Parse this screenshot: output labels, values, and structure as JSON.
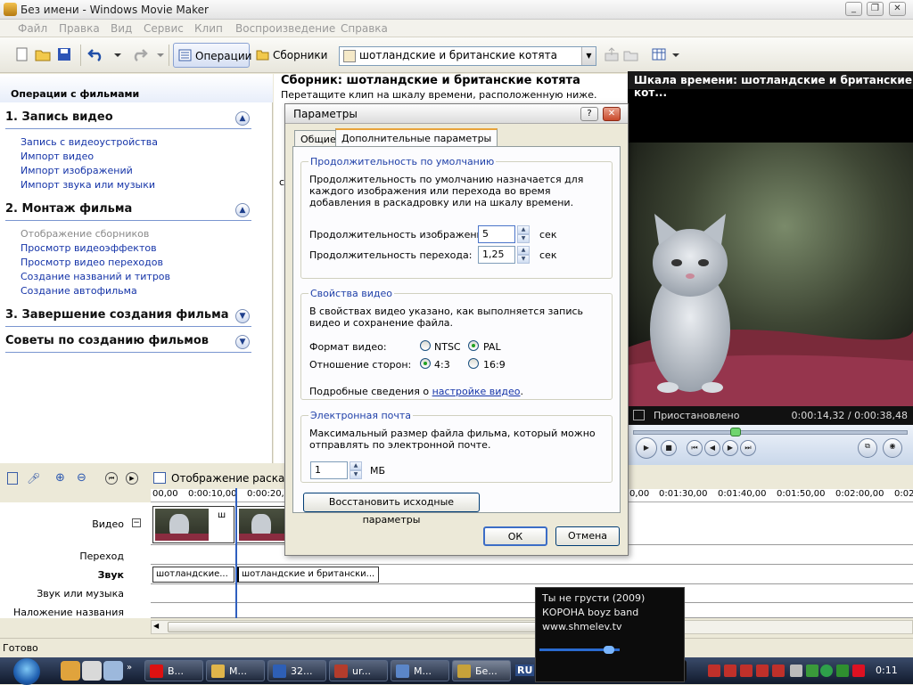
{
  "window": {
    "title": "Без имени - Windows Movie Maker"
  },
  "menu": [
    "Файл",
    "Правка",
    "Вид",
    "Сервис",
    "Клип",
    "Воспроизведение",
    "Справка"
  ],
  "toolbar": {
    "operations_label": "Операции",
    "collections_label": "Сборники",
    "collection_selected": "шотландские и британские котята"
  },
  "taskpane": {
    "header": "Операции с фильмами",
    "sections": [
      {
        "title": "1. Запись видео",
        "links": [
          "Запись с видеоустройства",
          "Импорт видео",
          "Импорт изображений",
          "Импорт звука или музыки"
        ]
      },
      {
        "title": "2. Монтаж фильма",
        "links": [
          "Отображение сборников",
          "Просмотр видеоэффектов",
          "Просмотр видео переходов",
          "Создание названий и титров",
          "Создание автофильма"
        ]
      },
      {
        "title": "3. Завершение создания фильма"
      },
      {
        "title": "Советы по созданию фильмов"
      }
    ]
  },
  "collection": {
    "title": "Сборник: шотландские и британские котята",
    "subtitle": "Перетащите клип на шкалу времени, расположенную ниже.",
    "fragment": "с"
  },
  "monitor": {
    "title": "Шкала времени: шотландские и британские кот...",
    "status": "Приостановлено",
    "time": "0:00:14,32 / 0:00:38,48",
    "progress": 0.372
  },
  "dialog": {
    "title": "Параметры",
    "tabs": [
      "Общие",
      "Дополнительные параметры"
    ],
    "duration": {
      "legend": "Продолжительность по умолчанию",
      "desc": "Продолжительность по умолчанию назначается для каждого изображения или перехода во время добавления в раскадровку или на шкалу времени.",
      "image_label": "Продолжительность изображения:",
      "image_value": "5",
      "transition_label": "Продолжительность перехода:",
      "transition_value": "1,25",
      "unit": "сек"
    },
    "video": {
      "legend": "Свойства видео",
      "desc": "В свойствах видео указано, как выполняется запись видео и сохранение файла.",
      "format_label": "Формат видео:",
      "ntsc": "NTSC",
      "pal": "PAL",
      "aspect_label": "Отношение сторон:",
      "a43": "4:3",
      "a169": "16:9",
      "more_prefix": "Подробные сведения о ",
      "more_link": "настройке видео",
      "more_suffix": "."
    },
    "email": {
      "legend": "Электронная почта",
      "desc": "Максимальный размер файла фильма, который можно отправлять по электронной почте.",
      "value": "1",
      "unit": "МБ"
    },
    "restore": "Восстановить исходные параметры",
    "ok": "ОК",
    "cancel": "Отмена"
  },
  "timeline": {
    "toolbar_label": "Отображение раскадр",
    "ruler": [
      "00,00",
      "0:00:10,00",
      "0:00:20,0",
      "0,00",
      "0:01:30,00",
      "0:01:40,00",
      "0:01:50,00",
      "0:02:00,00",
      "0:02"
    ],
    "tracks": [
      "Видео",
      "Переход",
      "Звук",
      "Звук или музыка",
      "Наложение названия"
    ],
    "video_clip_label": "ш",
    "audio_clips": [
      "шотландские...",
      "шотландские и британски..."
    ]
  },
  "status": "Готово",
  "taskbar": {
    "tasks": [
      "В...",
      "М...",
      "32...",
      "ur...",
      "М...",
      "Бе..."
    ],
    "lang": "RU",
    "clock": "0:11"
  },
  "media": {
    "line1": "Ты не грусти (2009)",
    "line2": "КОРОНА boyz band",
    "line3": "www.shmelev.tv"
  }
}
